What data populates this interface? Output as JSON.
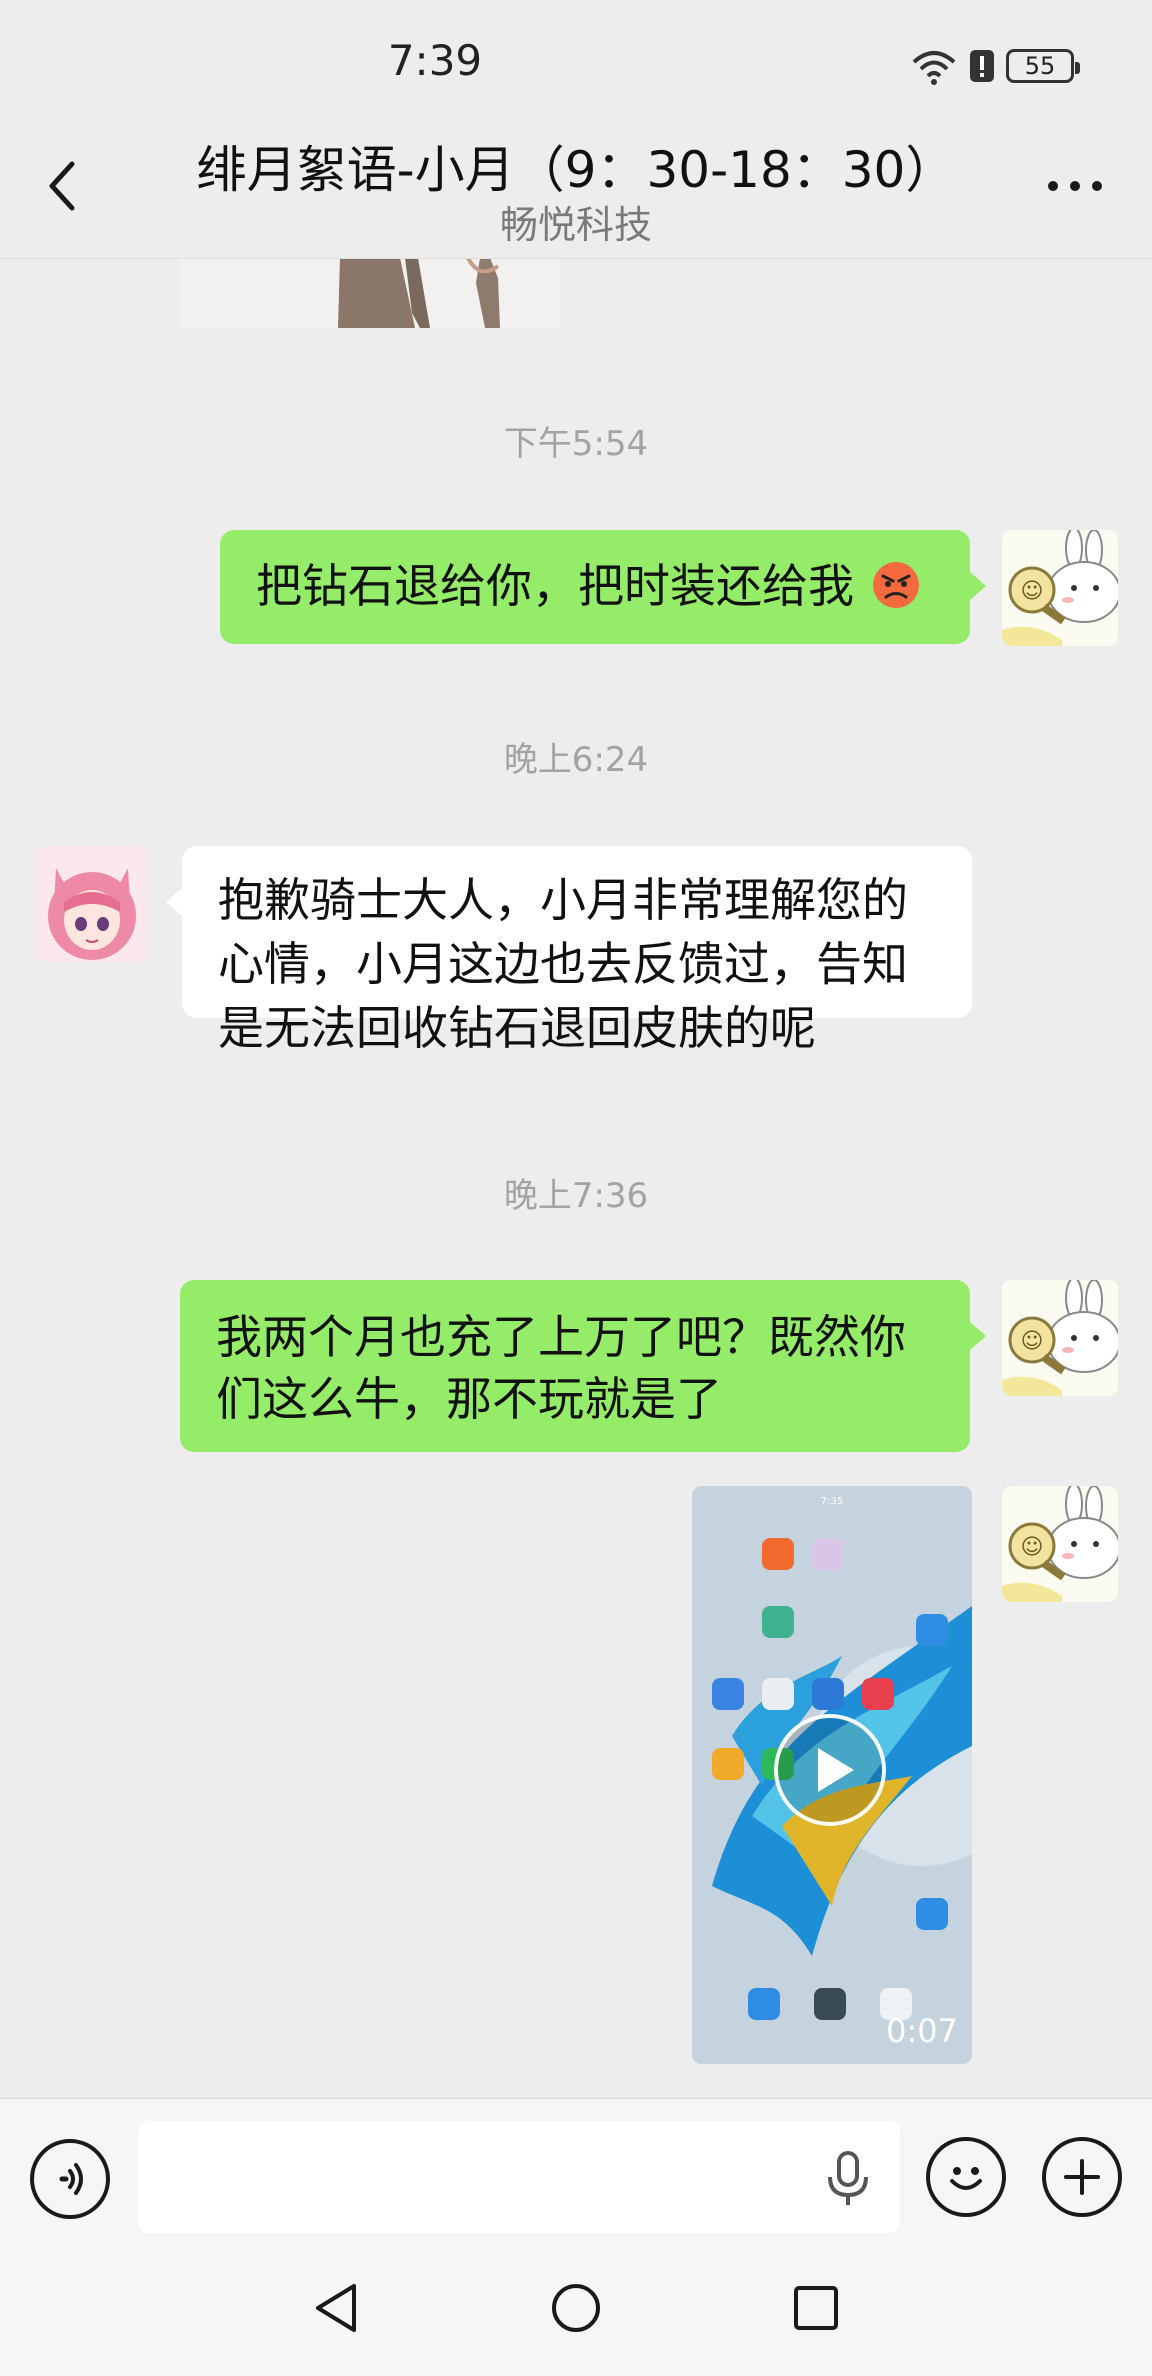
{
  "status_bar": {
    "time": "7:39",
    "battery": "55",
    "icons": [
      "wifi-icon",
      "alert-icon",
      "battery-icon"
    ]
  },
  "header": {
    "title": "绯月絮语-小月（9：30-18：30）",
    "subtitle": "畅悦科技"
  },
  "messages": [
    {
      "type": "timestamp",
      "text": "下午5:54"
    },
    {
      "type": "text",
      "from": "me",
      "text": "把钻石退给你，把时装还给我",
      "emoji": "angry-face-emoji"
    },
    {
      "type": "timestamp",
      "text": "晚上6:24"
    },
    {
      "type": "text",
      "from": "other",
      "lines": [
        "抱歉骑士大人，小月非常理解您的",
        "心情，小月这边也去反馈过，告知",
        "是无法回收钻石退回皮肤的呢"
      ]
    },
    {
      "type": "timestamp",
      "text": "晚上7:36"
    },
    {
      "type": "text",
      "from": "me",
      "lines": [
        "我两个月也充了上万了吧？既然你",
        "们这么牛，那不玩就是了"
      ]
    },
    {
      "type": "video",
      "from": "me",
      "duration": "0:07",
      "inner_time": "7:35"
    }
  ],
  "input": {
    "placeholder": ""
  },
  "colors": {
    "me_bubble": "#95ec69",
    "other_bubble": "#ffffff",
    "background": "#ededed"
  }
}
